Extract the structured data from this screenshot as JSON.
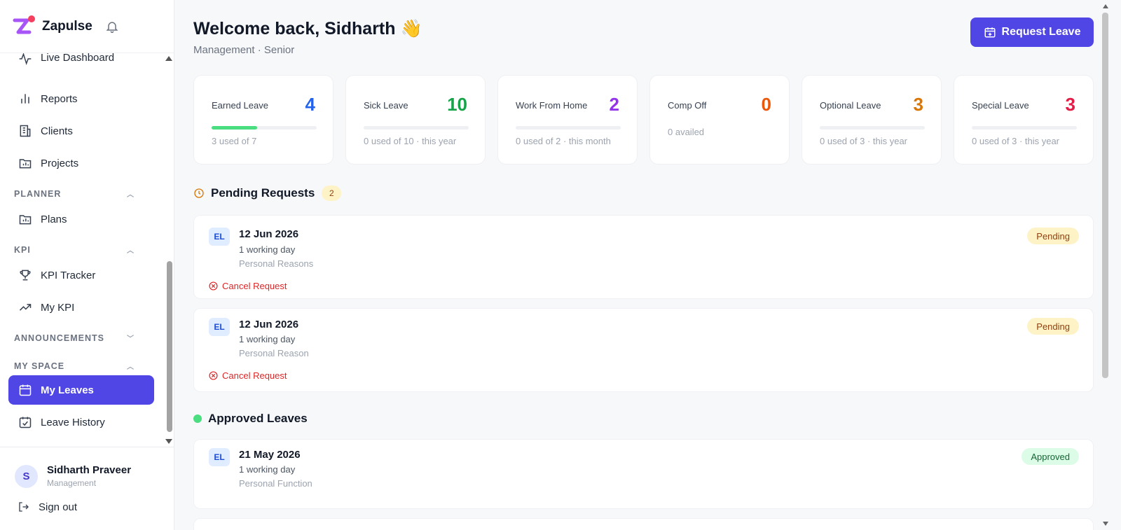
{
  "app": {
    "name": "Zapulse"
  },
  "sidebar": {
    "top_items": [
      {
        "label": "Live Dashboard",
        "icon": "activity-icon"
      },
      {
        "label": "Reports",
        "icon": "bar-chart-icon"
      },
      {
        "label": "Clients",
        "icon": "building-icon"
      },
      {
        "label": "Projects",
        "icon": "folder-chart-icon"
      }
    ],
    "sections": {
      "planner": {
        "title": "PLANNER",
        "items": [
          {
            "label": "Plans"
          }
        ]
      },
      "kpi": {
        "title": "KPI",
        "items": [
          {
            "label": "KPI Tracker"
          },
          {
            "label": "My KPI"
          }
        ]
      },
      "announcements": {
        "title": "ANNOUNCEMENTS"
      },
      "my_space": {
        "title": "MY SPACE",
        "items": [
          {
            "label": "My Leaves",
            "active": true
          },
          {
            "label": "Leave History"
          }
        ]
      }
    },
    "user": {
      "initial": "S",
      "name": "Sidharth Praveer",
      "dept": "Management"
    },
    "signout_label": "Sign out"
  },
  "header": {
    "welcome": "Welcome back, Sidharth",
    "wave_emoji": "👋",
    "subtitle": "Management · Senior",
    "request_button": "Request Leave"
  },
  "cards": [
    {
      "label": "Earned Leave",
      "value": "4",
      "color": "#2563eb",
      "sub": "3 used of 7",
      "progress": 0.43,
      "has_bar": true
    },
    {
      "label": "Sick Leave",
      "value": "10",
      "color": "#16a34a",
      "sub": "0 used of 10 · this year",
      "progress": 0,
      "has_bar": true
    },
    {
      "label": "Work From Home",
      "value": "2",
      "color": "#9333ea",
      "sub": "0 used of 2 · this month",
      "progress": 0,
      "has_bar": true
    },
    {
      "label": "Comp Off",
      "value": "0",
      "color": "#ea580c",
      "sub": "0 availed",
      "progress": 0,
      "has_bar": false
    },
    {
      "label": "Optional Leave",
      "value": "3",
      "color": "#d97706",
      "sub": "0 used of 3 · this year",
      "progress": 0,
      "has_bar": true
    },
    {
      "label": "Special Leave",
      "value": "3",
      "color": "#e11d48",
      "sub": "0 used of 3 · this year",
      "progress": 0,
      "has_bar": true
    }
  ],
  "pending": {
    "title": "Pending Requests",
    "count": "2",
    "items": [
      {
        "type": "EL",
        "date": "12 Jun 2026",
        "days": "1 working day",
        "reason": "Personal Reasons",
        "status": "Pending",
        "cancel": "Cancel Request"
      },
      {
        "type": "EL",
        "date": "12 Jun 2026",
        "days": "1 working day",
        "reason": "Personal Reason",
        "status": "Pending",
        "cancel": "Cancel Request"
      }
    ]
  },
  "approved": {
    "title": "Approved Leaves",
    "items": [
      {
        "type": "EL",
        "date": "21 May 2026",
        "days": "1 working day",
        "reason": "Personal Function",
        "status": "Approved"
      }
    ]
  }
}
